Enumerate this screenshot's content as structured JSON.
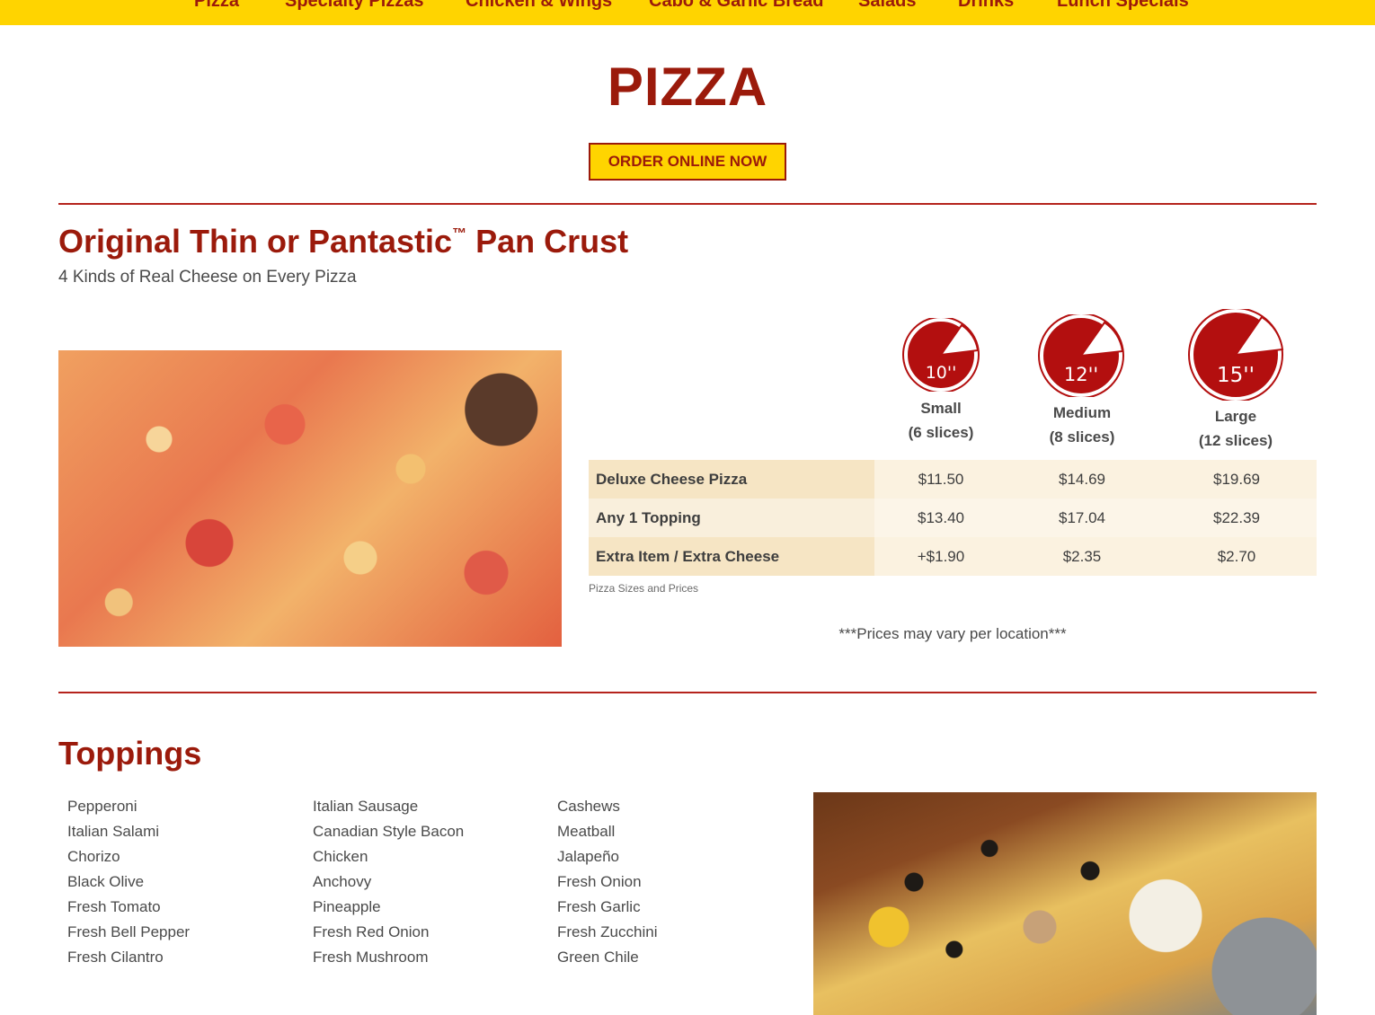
{
  "nav": {
    "items": [
      "Pizza",
      "Specialty Pizzas",
      "Chicken & Wings",
      "Cabo & Garlic Bread",
      "Salads",
      "Drinks",
      "Lunch Specials"
    ]
  },
  "page_title": "PIZZA",
  "order_button": "ORDER ONLINE NOW",
  "crust_section": {
    "title_part1": "Original Thin or Pantastic",
    "title_tm": "™",
    "title_part2": " Pan Crust",
    "subtitle": "4 Kinds of Real Cheese on Every Pizza",
    "sizes": [
      {
        "icon_label": "10''",
        "name": "Small",
        "slices": "(6 slices)"
      },
      {
        "icon_label": "12''",
        "name": "Medium",
        "slices": "(8 slices)"
      },
      {
        "icon_label": "15''",
        "name": "Large",
        "slices": "(12 slices)"
      }
    ],
    "price_rows": [
      {
        "item": "Deluxe Cheese Pizza",
        "prices": [
          "$11.50",
          "$14.69",
          "$19.69"
        ]
      },
      {
        "item": "Any 1 Topping",
        "prices": [
          "$13.40",
          "$17.04",
          "$22.39"
        ]
      },
      {
        "item": "Extra Item / Extra Cheese",
        "prices": [
          "+$1.90",
          "$2.35",
          "$2.70"
        ]
      }
    ],
    "table_caption": "Pizza Sizes and Prices",
    "note": "***Prices may vary per location***"
  },
  "toppings_section": {
    "title": "Toppings",
    "columns": [
      [
        "Pepperoni",
        "Italian Salami",
        "Chorizo",
        "Black Olive",
        "Fresh Tomato",
        "Fresh Bell Pepper",
        "Fresh Cilantro"
      ],
      [
        "Italian Sausage",
        "Canadian Style Bacon",
        "Chicken",
        "Anchovy",
        "Pineapple",
        "Fresh Red Onion",
        "Fresh Mushroom"
      ],
      [
        "Cashews",
        "Meatball",
        "Jalapeño",
        "Fresh Onion",
        "Fresh Garlic",
        "Fresh Zucchini",
        "Green Chile"
      ]
    ]
  },
  "colors": {
    "brand_red": "#9b1a0b",
    "brand_yellow": "#ffd400",
    "icon_red": "#b30f0f"
  }
}
